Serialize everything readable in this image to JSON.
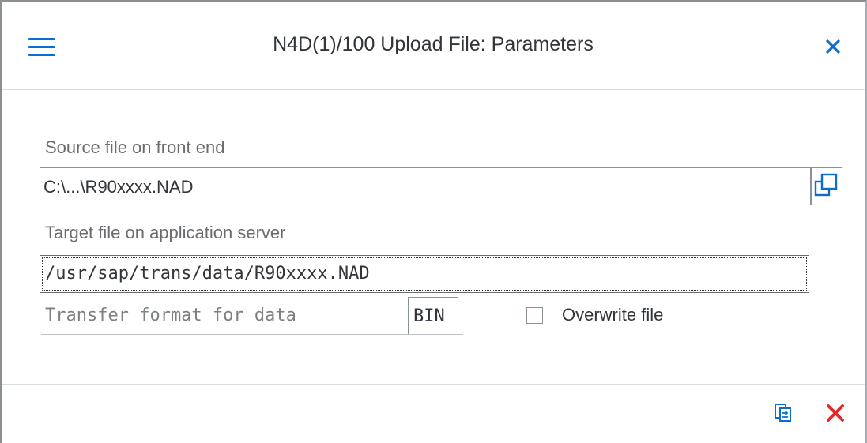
{
  "dialog": {
    "title": "N4D(1)/100 Upload File: Parameters"
  },
  "fields": {
    "source_label": "Source file on front end",
    "source_value": "C:\\...\\R90xxxx.NAD",
    "target_label": "Target file on application server",
    "target_value": "/usr/sap/trans/data/R90xxxx.NAD",
    "format_label": "Transfer format for data",
    "format_value": "BIN",
    "overwrite_label": "Overwrite file",
    "overwrite_checked": false
  },
  "icons": {
    "menu": "hamburger-menu-icon",
    "close": "close-icon",
    "value_help": "value-help-icon",
    "execute": "execute-icon",
    "cancel": "cancel-icon"
  },
  "colors": {
    "accent": "#0a6ed1",
    "cancel_red": "#e52929",
    "label_gray": "#6a6d70",
    "text": "#32363a"
  }
}
